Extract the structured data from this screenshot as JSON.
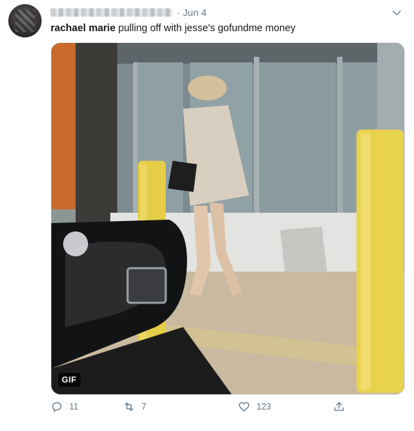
{
  "tweet": {
    "display_name_obscured": "",
    "date_separator": "·",
    "date": "Jun 4",
    "author_label": "rachael marie",
    "body": "pulling off with jesse's gofundme money"
  },
  "media": {
    "badge": "GIF"
  },
  "actions": {
    "reply_count": "11",
    "retweet_count": "7",
    "like_count": "123"
  },
  "icons": [
    "avatar",
    "chevron-down-icon",
    "reply-icon",
    "retweet-icon",
    "like-icon",
    "share-icon"
  ],
  "colors": {
    "text": "#14171a",
    "secondary": "#657786",
    "bollard": "#e8cf4a"
  }
}
